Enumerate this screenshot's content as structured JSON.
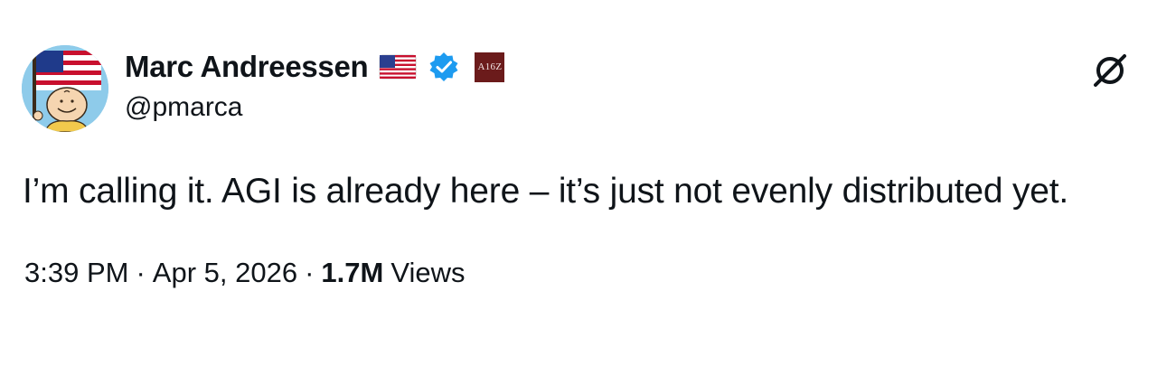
{
  "author": {
    "display_name": "Marc Andreessen",
    "handle": "@pmarca",
    "flag_icon": "us-flag-icon",
    "verified_icon": "verified-badge-icon",
    "verified_color": "#1d9bf0",
    "affiliate_badge_text": "A16Z",
    "affiliate_badge_color": "#6b1b1b",
    "avatar_icon": "charlie-brown-with-flag-avatar"
  },
  "tweet": {
    "text": "I’m calling it. AGI is already here – it’s just not evenly distributed yet."
  },
  "meta": {
    "time": "3:39 PM",
    "separator": "·",
    "date": "Apr 5, 2026",
    "views_count": "1.7M",
    "views_label": "Views"
  },
  "corner_icon": "slashed-circle-icon"
}
